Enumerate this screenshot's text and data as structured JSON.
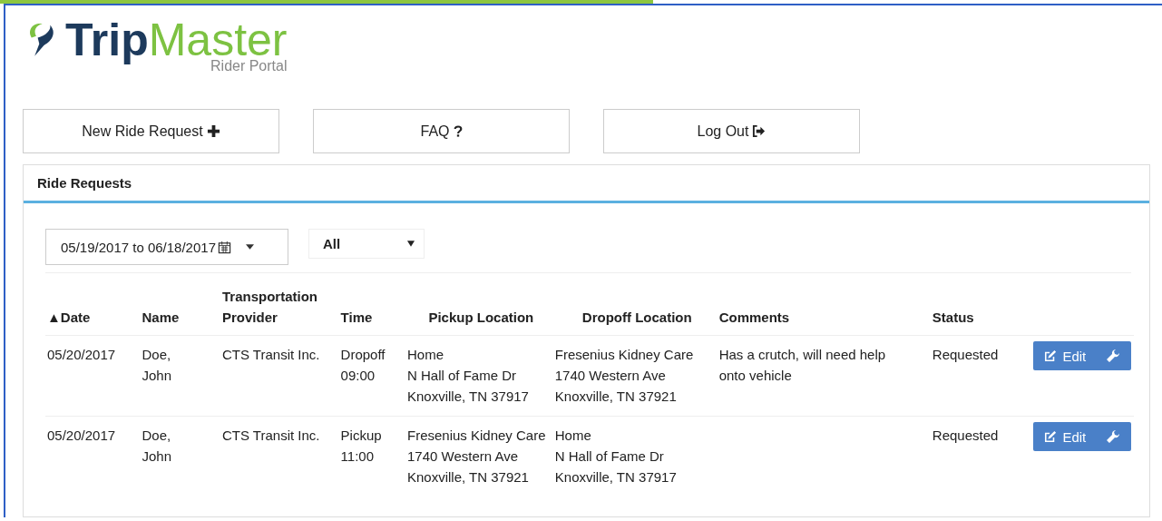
{
  "logo": {
    "word_1": "Trip",
    "word_2": "Master",
    "subtitle": "Rider Portal"
  },
  "actions": [
    {
      "label": "New Ride Request",
      "kind": "add"
    },
    {
      "label": "FAQ",
      "kind": "help"
    },
    {
      "label": "Log Out",
      "kind": "logout"
    }
  ],
  "panel": {
    "title": "Ride Requests",
    "date_range": {
      "value": "05/19/2017 to 06/18/2017"
    },
    "status_filter": {
      "value": "All"
    },
    "table": {
      "columns": [
        {
          "label": "Date",
          "sort_indicator": "▲"
        },
        {
          "label": "Name"
        },
        {
          "label": "Transportation Provider"
        },
        {
          "label": "Time"
        },
        {
          "label": "Pickup Location"
        },
        {
          "label": "Dropoff Location"
        },
        {
          "label": "Comments"
        },
        {
          "label": "Status"
        }
      ],
      "rows": [
        {
          "date": "05/20/2017",
          "name": [
            "Doe,",
            "John"
          ],
          "provider": "CTS Transit Inc.",
          "time": [
            "Dropoff",
            "09:00"
          ],
          "pickup": [
            "Home",
            "N Hall of Fame Dr",
            "Knoxville, TN 37917"
          ],
          "dropoff": [
            "Fresenius Kidney Care",
            "1740 Western Ave",
            "Knoxville, TN 37921"
          ],
          "comments": "Has a crutch, will need help onto vehicle",
          "status": "Requested",
          "action": "Edit"
        },
        {
          "date": "05/20/2017",
          "name": [
            "Doe,",
            "John"
          ],
          "provider": "CTS Transit Inc.",
          "time": [
            "Pickup",
            "11:00"
          ],
          "pickup": [
            "Fresenius Kidney Care",
            "1740 Western Ave",
            "Knoxville, TN 37921"
          ],
          "dropoff": [
            "Home",
            "N Hall of Fame Dr",
            "Knoxville, TN 37917"
          ],
          "comments": "",
          "status": "Requested",
          "action": "Edit"
        }
      ]
    }
  }
}
